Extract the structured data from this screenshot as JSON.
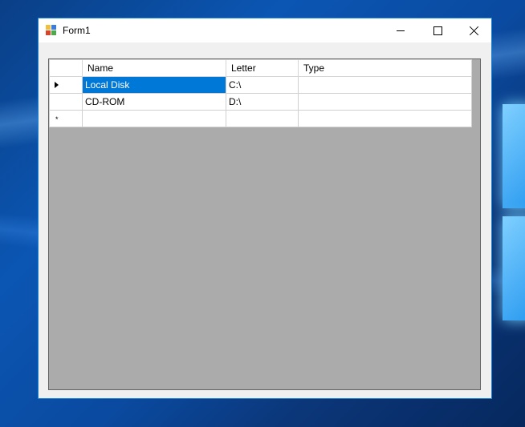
{
  "window": {
    "title": "Form1"
  },
  "grid": {
    "columns": [
      "Name",
      "Letter",
      "Type"
    ],
    "rows": [
      {
        "name": "Local Disk",
        "letter": "C:\\",
        "type": "",
        "selected": true,
        "current": true
      },
      {
        "name": "CD-ROM",
        "letter": "D:\\",
        "type": ""
      }
    ],
    "new_row_marker": "*"
  },
  "icons": {
    "app": "form-app-icon",
    "current_row": "row-indicator-arrow-icon"
  },
  "colors": {
    "selection": "#0078d7",
    "grid_background": "#ababab",
    "window_border": "#1883d7"
  }
}
